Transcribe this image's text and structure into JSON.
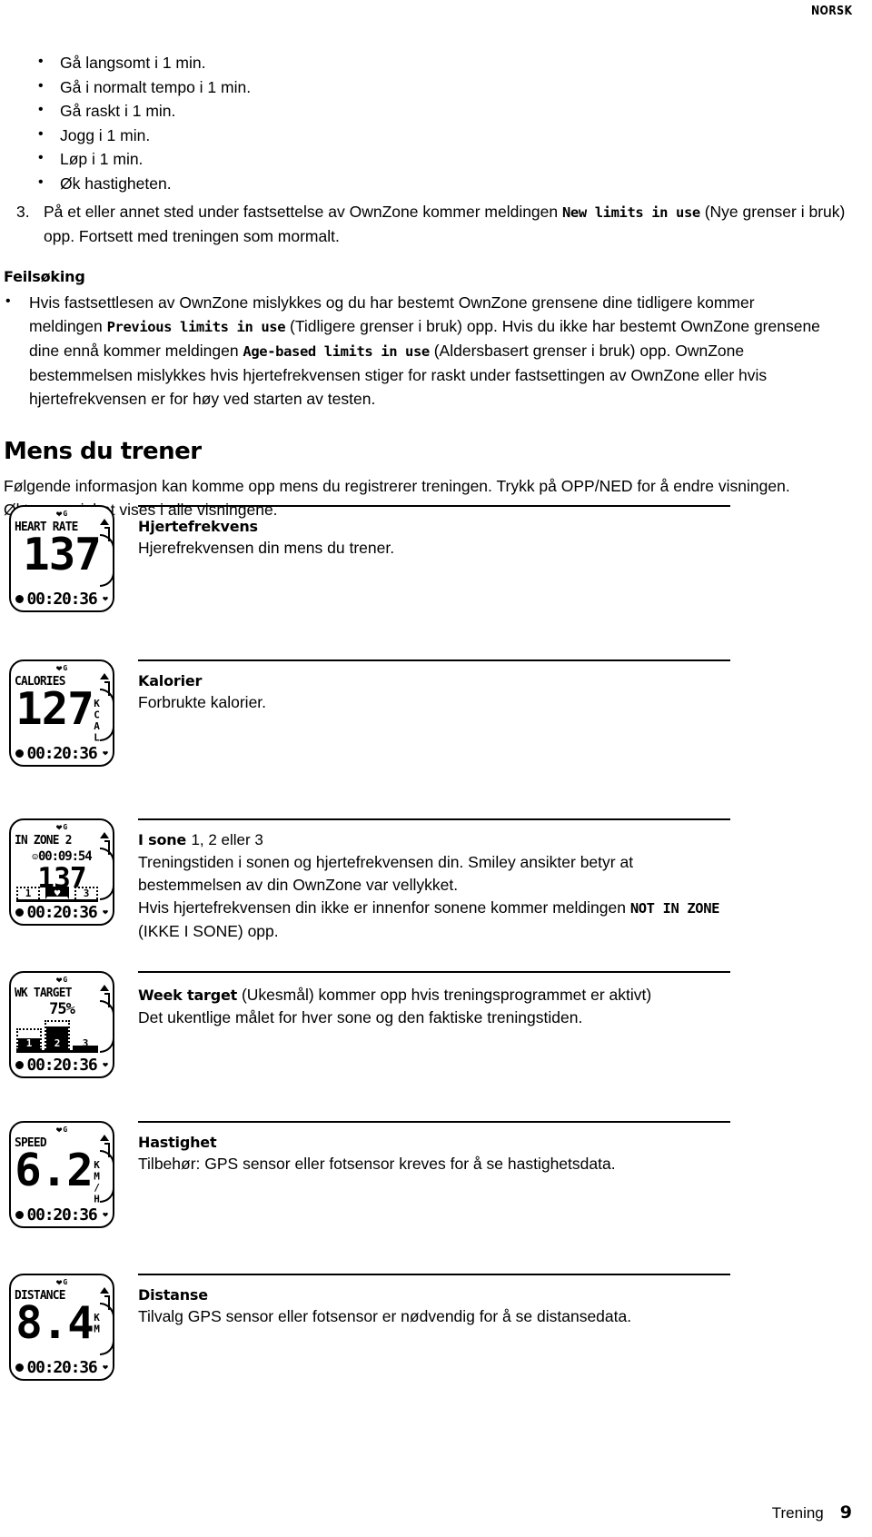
{
  "header": {
    "language_tag": "NORSK"
  },
  "bullets": [
    "Gå langsomt i 1 min.",
    "Gå i normalt tempo i 1 min.",
    "Gå raskt i 1 min.",
    "Jogg i 1 min.",
    "Løp i 1 min.",
    "Øk hastigheten."
  ],
  "step3": {
    "number": "3.",
    "text_before": "På et eller annet sted under fastsettelse av OwnZone kommer meldingen ",
    "message": "New limits in use",
    "text_after": " (Nye grenser i bruk) opp. Fortsett med treningen som mormalt."
  },
  "troubleshooting": {
    "heading": "Feilsøking",
    "bullet": {
      "part1": "Hvis fastsettlesen av OwnZone mislykkes og du har bestemt OwnZone grensene dine tidligere kommer meldingen ",
      "msg1": "Previous limits in use",
      "part2": " (Tidligere grenser i bruk) opp. Hvis du ikke har bestemt OwnZone grensene dine ennå kommer meldingen ",
      "msg2": "Age-based limits in use",
      "part3": " (Aldersbasert grenser i bruk) opp. OwnZone bestemmelsen mislykkes hvis hjertefrekvensen stiger for raskt under fastsettingen av OwnZone eller hvis hjertefrekvensen er for høy ved starten av testen."
    }
  },
  "while_training": {
    "heading": "Mens du trener",
    "intro": "Følgende informasjon kan komme opp mens du registrerer treningen. Trykk på OPP/NED for å endre visningen. Øktens varighet vises i alle visningene."
  },
  "displays": [
    {
      "id": "heart-rate",
      "watch": {
        "label": "HEART RATE",
        "value": "137",
        "unit": "",
        "time": "00:20:36",
        "heart_icon": "heart-icon",
        "g_icon": "G"
      },
      "title": "Hjertefrekvens",
      "desc": "Hjerefrekvensen din mens du trener."
    },
    {
      "id": "calories",
      "watch": {
        "label": "CALORIES",
        "value": "127",
        "unit": "KCAL",
        "time": "00:20:36",
        "heart_icon": "heart-icon",
        "g_icon": "G"
      },
      "title": "Kalorier",
      "desc": "Forbrukte kalorier."
    },
    {
      "id": "in-zone",
      "watch": {
        "label": "IN ZONE 2",
        "zone_time": "00:09:54",
        "value": "137",
        "time": "00:20:36",
        "zones": [
          "1",
          "♥",
          "3"
        ],
        "filled_zone_index": 1,
        "smiley_icon": "smiley-icon",
        "heart_icon": "heart-icon",
        "g_icon": "G"
      },
      "title_bold": "I sone ",
      "title_rest": "1, 2 eller 3",
      "desc1": "Treningstiden i sonen og hjertefrekvensen din. Smiley ansikter betyr at bestemmelsen av din OwnZone var vellykket.",
      "desc2_before": "Hvis hjertefrekvensen din ikke er innenfor sonene kommer meldingen ",
      "desc2_msg": "NOT IN ZONE",
      "desc2_after": " (IKKE I SONE) opp."
    },
    {
      "id": "week-target",
      "watch": {
        "label": "WK TARGET",
        "percent": "75%",
        "time": "00:20:36",
        "bars": [
          {
            "label": "1",
            "fill_pct": 55,
            "inverted": true
          },
          {
            "label": "2",
            "fill_pct": 78,
            "inverted": true
          },
          {
            "label": "3",
            "fill_pct": 18,
            "inverted": false
          }
        ],
        "heart_icon": "heart-icon",
        "g_icon": "G"
      },
      "title_msg": "Week target",
      "title_rest": " (Ukesmål) kommer opp hvis treningsprogrammet er aktivt)",
      "desc": "Det ukentlige målet for hver sone og den faktiske treningstiden."
    },
    {
      "id": "speed",
      "watch": {
        "label": "SPEED",
        "value": "6.2",
        "unit": "KM/H",
        "time": "00:20:36",
        "heart_icon": "heart-icon",
        "g_icon": "G"
      },
      "title": "Hastighet",
      "desc": "Tilbehør: GPS sensor eller fotsensor kreves for å se hastighetsdata."
    },
    {
      "id": "distance",
      "watch": {
        "label": "DISTANCE",
        "value": "8.4",
        "unit": "KM",
        "time": "00:20:36",
        "heart_icon": "heart-icon",
        "g_icon": "G"
      },
      "title": "Distanse",
      "desc": "Tilvalg GPS sensor eller fotsensor er nødvendig for å se distansedata."
    }
  ],
  "footer": {
    "section": "Trening",
    "page": "9"
  }
}
